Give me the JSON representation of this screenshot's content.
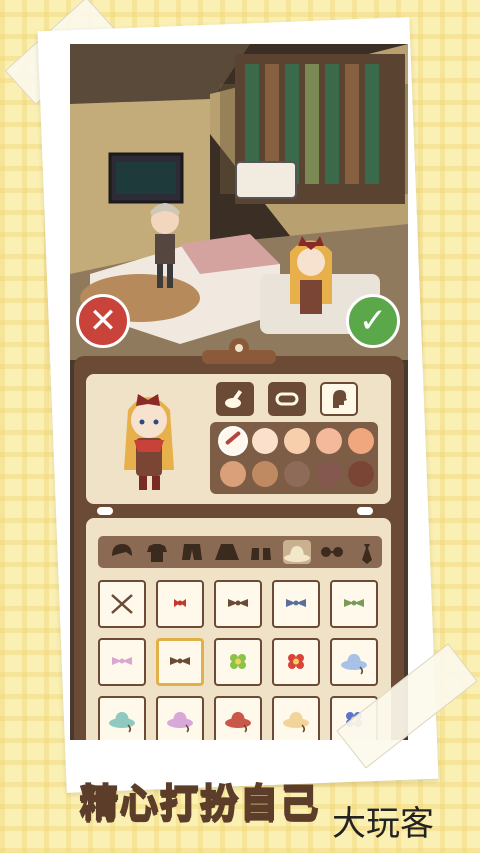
{
  "caption": "精心打扮自己",
  "watermark": "大玩客",
  "controls": {
    "cancel_icon": "close-icon",
    "confirm_icon": "check-icon"
  },
  "colors": {
    "panel_brown": "#6b4a36",
    "card_cream": "#efe2c6",
    "cancel_red": "#c9433a",
    "confirm_green": "#5aa84a",
    "accent_gold": "#e0b04a"
  },
  "tools": [
    "color-brush-icon",
    "hair-sample-icon",
    "head-silhouette-icon"
  ],
  "active_tool": 2,
  "skin_swatches": [
    "#fff7ee",
    "#fbe0cb",
    "#f7cfac",
    "#f4b99b",
    "#f1a77e",
    "#d9a07a",
    "#bf8a62",
    "#8e6a58",
    "#84574f",
    "#7a4534"
  ],
  "selected_swatch": 0,
  "categories": [
    "hair-icon",
    "top-icon",
    "bottom-icon",
    "skirt-icon",
    "shoes-icon",
    "hat-icon",
    "glasses-icon",
    "tie-icon"
  ],
  "active_category": 5,
  "items": [
    "none-icon",
    "red-bow-icon",
    "brown-bow-icon",
    "blue-bow-icon",
    "green-bow-icon",
    "pink-bow-icon",
    "brown-bow-icon",
    "green-flower-icon",
    "red-flower-icon",
    "blue-sunhat-icon",
    "teal-hat-icon",
    "pink-hat-icon",
    "red-hat-icon",
    "cream-hat-icon",
    "blue-flower-icon"
  ],
  "selected_item": 6
}
